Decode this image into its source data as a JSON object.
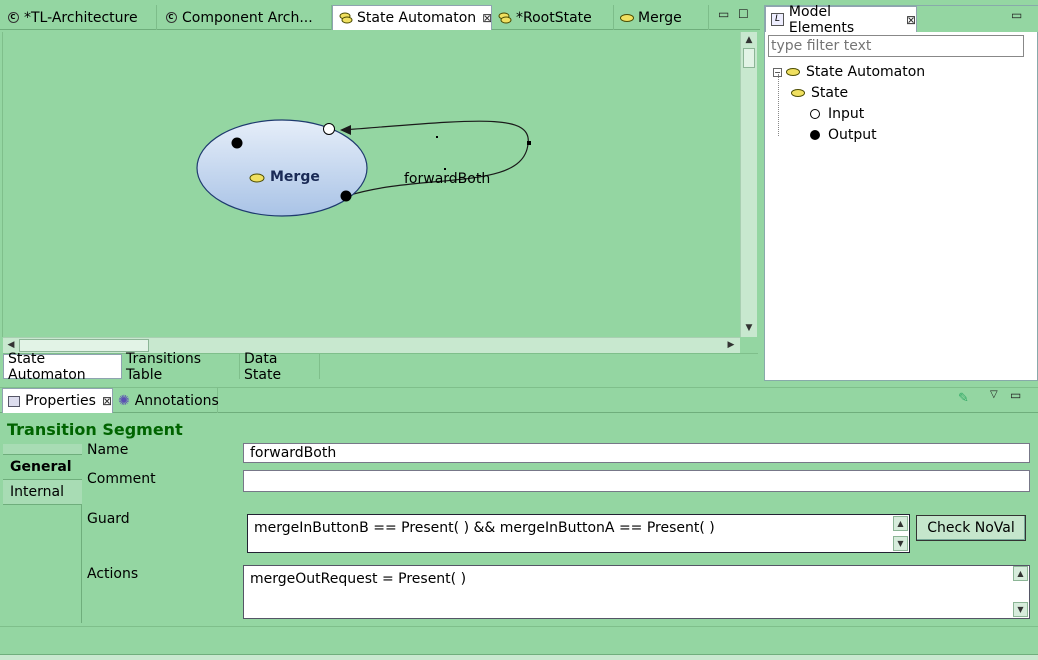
{
  "editor": {
    "tabs": [
      {
        "label": "*TL-Architecture",
        "icon": "component-c-icon"
      },
      {
        "label": "Component Arch...",
        "icon": "component-c-icon"
      },
      {
        "label": "State Automaton",
        "icon": "state-automaton-icon",
        "active": true
      },
      {
        "label": "*RootState",
        "icon": "state-automaton-icon"
      },
      {
        "label": "Merge",
        "icon": "state-oval-icon"
      }
    ],
    "close_glyph": "⊠",
    "minimize_glyph": "▭",
    "maximize_glyph": "☐",
    "diagram": {
      "state_name": "Merge",
      "transition_label": "forwardBoth"
    },
    "bottom_tabs": [
      "State Automaton",
      "Transitions Table",
      "Data State"
    ]
  },
  "model_view": {
    "title": "Model Elements",
    "filter_placeholder": "type filter text",
    "tree": {
      "root": "State Automaton",
      "children": [
        "State",
        "Input",
        "Output"
      ]
    }
  },
  "properties": {
    "tabs": [
      "Properties",
      "Annotations"
    ],
    "section_title": "Transition Segment",
    "left_tabs": [
      "General",
      "Internal"
    ],
    "fields": {
      "name_label": "Name",
      "name_value": "forwardBoth",
      "comment_label": "Comment",
      "comment_value": "",
      "guard_label": "Guard",
      "guard_value": "mergeInButtonB == Present( ) && mergeInButtonA == Present( )",
      "actions_label": "Actions",
      "actions_value": "mergeOutRequest = Present( )"
    },
    "check_button_label": "Check NoVal"
  },
  "colors": {
    "background": "#94d6a2",
    "section_title": "#006400",
    "state_fill": "#c6d8f0"
  }
}
